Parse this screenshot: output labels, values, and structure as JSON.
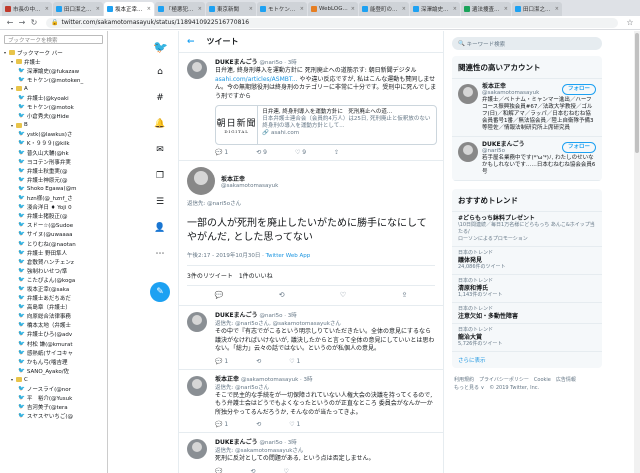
{
  "tabs": [
    {
      "title": "市長の中...",
      "color": "#c0392b"
    },
    {
      "title": "田口潔之...",
      "color": "#1da1f2"
    },
    {
      "title": "坂本正幸...",
      "color": "#1da1f2",
      "active": true
    },
    {
      "title": "「極悪犯...",
      "color": "#1da1f2"
    },
    {
      "title": "東京新聞",
      "color": "#1da1f2"
    },
    {
      "title": "モトケン...",
      "color": "#1da1f2"
    },
    {
      "title": "WebLOG...",
      "color": "#e67e22"
    },
    {
      "title": "能登町の...",
      "color": "#1da1f2"
    },
    {
      "title": "深澤諭史...",
      "color": "#1da1f2"
    },
    {
      "title": "遺法捜査...",
      "color": "#1aa35a"
    },
    {
      "title": "田口潔之...",
      "color": "#1da1f2"
    }
  ],
  "address": "twitter.com/sakamotomasayuk/status/1189410922516770816",
  "bookmarks": {
    "search_placeholder": "ブックマークを検索",
    "items": [
      {
        "t": "ブックマーク バー",
        "type": "folder",
        "lvl": 0
      },
      {
        "t": "弁護士",
        "type": "folder",
        "lvl": 1
      },
      {
        "t": "深澤諭史(@fukazaw",
        "type": "tw",
        "lvl": 2
      },
      {
        "t": "モトケン(@motoken_",
        "type": "tw",
        "lvl": 2
      },
      {
        "t": "A",
        "type": "folder",
        "lvl": 1
      },
      {
        "t": "弁護士(@kyoaki",
        "type": "tw",
        "lvl": 2
      },
      {
        "t": "モトケン(@motok",
        "type": "tw",
        "lvl": 2
      },
      {
        "t": "小倉秀夫(@Hide",
        "type": "tw",
        "lvl": 2
      },
      {
        "t": "B",
        "type": "folder",
        "lvl": 1
      },
      {
        "t": "ystk(@lawkus)さ",
        "type": "tw",
        "lvl": 2
      },
      {
        "t": "K・９９９(@kilk",
        "type": "tw",
        "lvl": 2
      },
      {
        "t": "普久山大輔(@hk",
        "type": "tw",
        "lvl": 2
      },
      {
        "t": "ヨコテン刑事弁実",
        "type": "tw",
        "lvl": 2
      },
      {
        "t": "弁護士秋重実(@",
        "type": "tw",
        "lvl": 2
      },
      {
        "t": "弁護士神原元(@",
        "type": "tw",
        "lvl": 2
      },
      {
        "t": "Shoko Egawa(@m",
        "type": "tw",
        "lvl": 2
      },
      {
        "t": "hzn様(@_hznf_さ",
        "type": "tw",
        "lvl": 2
      },
      {
        "t": "淺合洋日 ♦ Yoji 0",
        "type": "tw",
        "lvl": 2
      },
      {
        "t": "弁護士猪股正(@",
        "type": "tw",
        "lvl": 2
      },
      {
        "t": "スドー☆(@Sudoe",
        "type": "tw",
        "lvl": 2
      },
      {
        "t": "サイヌ(@uwaaaa",
        "type": "tw",
        "lvl": 2
      },
      {
        "t": "とりむね(@naotan",
        "type": "tw",
        "lvl": 2
      },
      {
        "t": "弁護士 野田隼人",
        "type": "tw",
        "lvl": 2
      },
      {
        "t": "倉敷賀ハンチェンz",
        "type": "tw",
        "lvl": 2
      },
      {
        "t": "強制わいせつ/準",
        "type": "tw",
        "lvl": 2
      },
      {
        "t": "こたぴよん(@koga",
        "type": "tw",
        "lvl": 2
      },
      {
        "t": "坂本正幸(@saka",
        "type": "tw",
        "lvl": 2
      },
      {
        "t": "弁護士あだちあだ",
        "type": "tw",
        "lvl": 2
      },
      {
        "t": "高島章（弁護士）",
        "type": "tw",
        "lvl": 2
      },
      {
        "t": "向原総合法律事務",
        "type": "tw",
        "lvl": 2
      },
      {
        "t": "橋本太地（弁護士",
        "type": "tw",
        "lvl": 2
      },
      {
        "t": "弁護士ひろ(@adv",
        "type": "tw",
        "lvl": 2
      },
      {
        "t": "村松 謙(@kmurat",
        "type": "tw",
        "lvl": 2
      },
      {
        "t": "感熱紙(サイコキャ",
        "type": "tw",
        "lvl": 2
      },
      {
        "t": "かもん弓(噛吉理",
        "type": "tw",
        "lvl": 2
      },
      {
        "t": "SANO_Ayako/佐",
        "type": "tw",
        "lvl": 2
      },
      {
        "t": "C",
        "type": "folder",
        "lvl": 1
      },
      {
        "t": "ノースライ(@nor",
        "type": "tw",
        "lvl": 2
      },
      {
        "t": "平　裕介(@Yusuk",
        "type": "tw",
        "lvl": 2
      },
      {
        "t": "吉河美子(@tera",
        "type": "tw",
        "lvl": 2
      },
      {
        "t": "スヤスヤいちご(@",
        "type": "tw",
        "lvl": 2
      }
    ]
  },
  "header": {
    "title": "ツイート"
  },
  "tweet1": {
    "name": "DUKEまんごう",
    "handle": "@nari5o · 3時",
    "text": "日弁連, 終身刑導入を運動方針に 死刑廃止への道筋示す: 朝日新聞デジタル",
    "link": "asahi.com/articles/ASMBT... ",
    "text2": "やや違い反応ですが, 私はこんな運動も賛同しません。今の無期懲役刑は終身刑のカテゴリーに非常に十分です。受刑中に死んでしまう刑ですから",
    "card_logo": "朝日新聞",
    "card_sub": "DIGITAL",
    "card_title": "日弁連, 終身刑導入を運動方針に　死刑廃止への道...",
    "card_desc": "日本弁護士連合会（会員約4万人）は25日, 死刑廃止と仮釈放のない終身刑の導入を運動方針として...",
    "card_url": "asahi.com",
    "replies": "1",
    "retweets": "9",
    "likes": "9"
  },
  "focus": {
    "name": "坂本正幸",
    "handle": "@sakamotomasayuk",
    "reply_to": "返信先: @nari5oさん",
    "text": "一部の人が死刑を廃止したいがために勝手になにしてやがんだ, とした思ってない",
    "meta": "午後2:17 - 2019年10月30日 · ",
    "via": "Twitter Web App",
    "rt_count": "3件のリツイート",
    "like_count": "1件のいいね"
  },
  "replies": [
    {
      "name": "DUKEまんごう",
      "handle": "@nari5o · 3時",
      "to": "返信先: @nari5oさん, @sakamotomasayukさん",
      "text": "その中で『有志でがこるという明示しりていただきたい。全体の意見にするなら議決がなければいけないが, 議決したからと言って全体の意見にしていいとは思わない。「総力」云々の話ではない。というのが私個人の意見。",
      "r": "1",
      "rt": "",
      "l": "1"
    },
    {
      "name": "坂本正幸",
      "handle": "@sakamotomasayuk · 3時",
      "to": "返信先: @nari5oさん",
      "text": "そこで民主的な手続をが一切保障されていない人権大会の決議を持ってくるので, もう弁護士会はどうでもよくなったというのが正直なところ 委員会がなんか一か所独分やってるんだろうか, そんなのが当たってきよ。",
      "r": "1",
      "rt": "",
      "l": "1"
    },
    {
      "name": "DUKEまんごう",
      "handle": "@nari5o · 3時",
      "to": "返信先: @sakamotomasayukさん",
      "text": "死刑に反対としての問題がある, という点は否定しません。",
      "r": "",
      "rt": "",
      "l": ""
    }
  ],
  "right": {
    "search_placeholder": "キーワード検索",
    "rel_title": "関連性の高いアカウント",
    "accounts": [
      {
        "name": "坂本正幸",
        "handle": "@sakamotomasayuk",
        "bio": "弁護士／ベトナム・ミャンマー進出／ハーフコース振興独会員#67／法政大学教授／ゴルフ(日)／和解アマ／ラッパ／日本むねむね協会員番号1番／無法協会員／陸上自衛隊予備3等陸佐／情報法制研究所上席研究員",
        "follow": "フォロー"
      },
      {
        "name": "DUKEまんごう",
        "handle": "@nari5o",
        "bio": "若手屋名業務中です(*'ω'*)ﾉ, わたしのせいなかもしれないです……日本むねむね協会会員6号",
        "follow": "フォロー"
      }
    ],
    "trend_title": "おすすめトレンド",
    "trends": [
      {
        "name": "#どらもっち鉢料プレゼント",
        "sub": "\\10日間連続／毎日1万名様にどらもっち あんこ&ホイップ当たる/",
        "promo": "ローソンによるプロモーション"
      },
      {
        "cat": "日本のトレンド",
        "name": "議体発見",
        "sub": "24,086件のツイート"
      },
      {
        "cat": "日本のトレンド",
        "name": "清原和博氏",
        "sub": "1,143件のツイート"
      },
      {
        "cat": "日本のトレンド",
        "name": "注意欠如・多動性障害",
        "sub": ""
      },
      {
        "cat": "日本のトレンド",
        "name": "龍治大賞",
        "sub": "5,726件のツイート"
      }
    ],
    "more": "さらに表示",
    "footer1": "利用規約　プライバシーポリシー　Cookie　広告情報",
    "footer2": "もっと見る ∨　© 2019 Twitter, Inc."
  }
}
